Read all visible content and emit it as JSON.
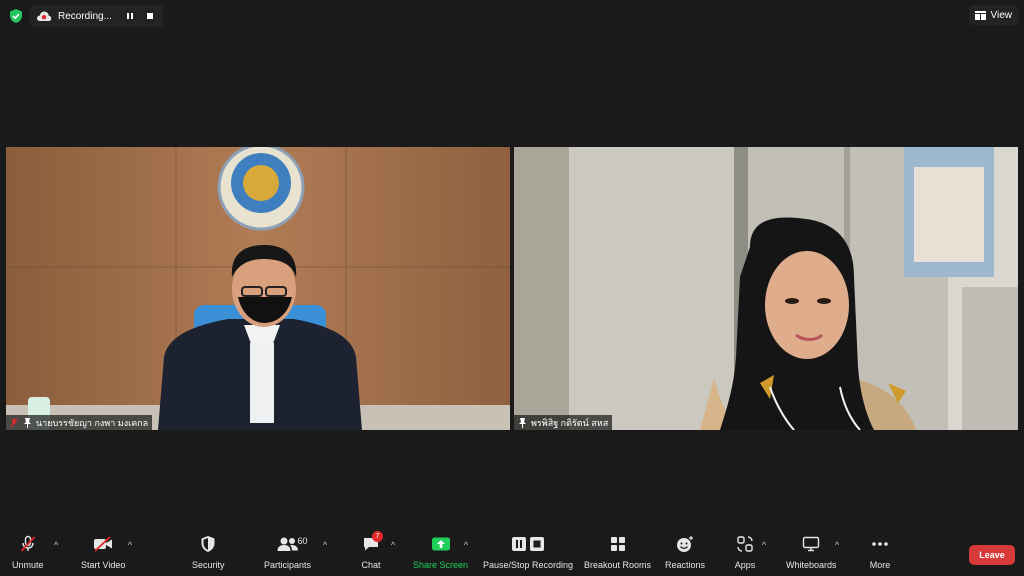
{
  "top_bar": {
    "recording_label": "Recording...",
    "view_label": "View"
  },
  "participants": [
    {
      "name": "นายบรรชัยญา กงพา มงเคกล"
    },
    {
      "name": "พรพิสิฐ กติรัตน์ สหส"
    }
  ],
  "toolbar": {
    "unmute": "Unmute",
    "start_video": "Start Video",
    "security": "Security",
    "participants": "Participants",
    "participants_count": "60",
    "chat": "Chat",
    "chat_badge": "7",
    "share_screen": "Share Screen",
    "pause_stop_recording": "Pause/Stop Recording",
    "breakout_rooms": "Breakout Rooms",
    "reactions": "Reactions",
    "apps": "Apps",
    "whiteboards": "Whiteboards",
    "more": "More",
    "leave": "Leave"
  },
  "colors": {
    "background": "#1a1a1a",
    "share_green": "#1fd15a",
    "leave_red": "#d63a3a",
    "badge_red": "#e02828",
    "shield_green": "#23c55e"
  }
}
